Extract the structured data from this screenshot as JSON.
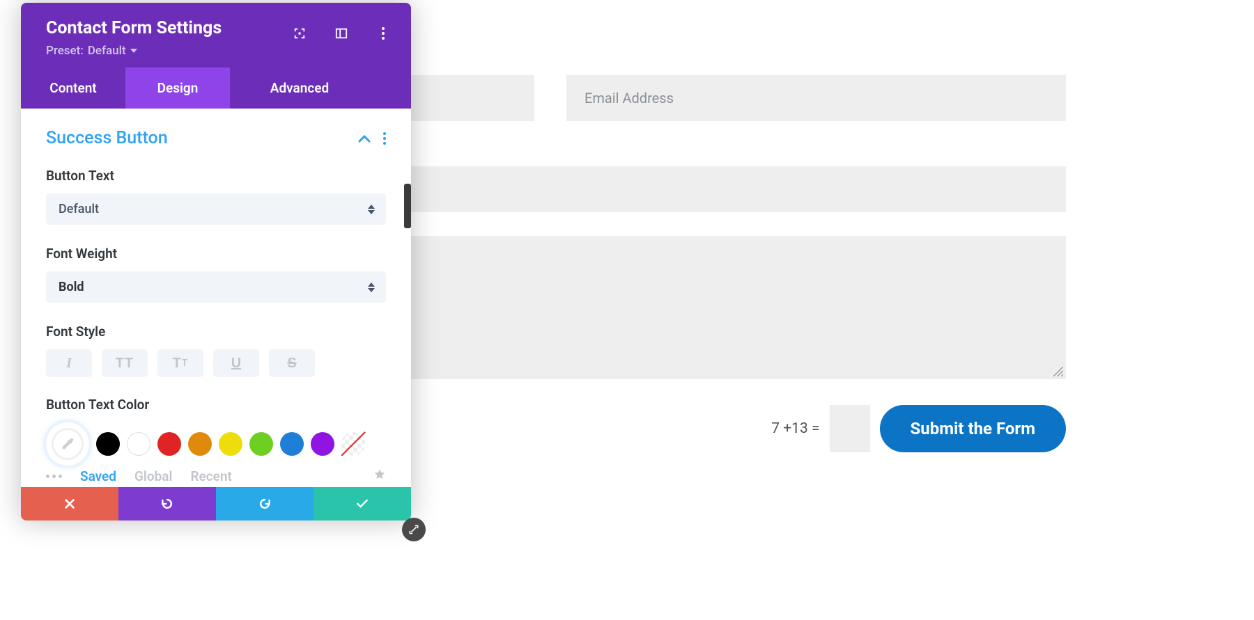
{
  "panel": {
    "title": "Contact Form Settings",
    "preset_prefix": "Preset:",
    "preset_value": "Default",
    "tabs": {
      "content": "Content",
      "design": "Design",
      "advanced": "Advanced",
      "active": "design"
    },
    "section_title": "Success Button",
    "fields": {
      "button_text": {
        "label": "Button Text",
        "value": "Default"
      },
      "font_weight": {
        "label": "Font Weight",
        "value": "Bold"
      },
      "font_style": {
        "label": "Font Style"
      },
      "text_color": {
        "label": "Button Text Color"
      }
    },
    "palette_tabs": {
      "saved": "Saved",
      "global": "Global",
      "recent": "Recent",
      "active": "saved"
    },
    "swatches": [
      "#000000",
      "#ffffff",
      "#e02424",
      "#e08a0b",
      "#edde0b",
      "#6ece22",
      "#1f7ed6",
      "#9115e2",
      "transparent"
    ]
  },
  "form": {
    "email_placeholder": "Email Address",
    "captcha": "7 +13 =",
    "submit_label": "Submit the Form"
  },
  "colors": {
    "brand_purple": "#6c2eb9",
    "brand_purple_light": "#8e44e9",
    "accent_blue": "#2ea3f2",
    "submit_blue": "#0b74c5"
  }
}
